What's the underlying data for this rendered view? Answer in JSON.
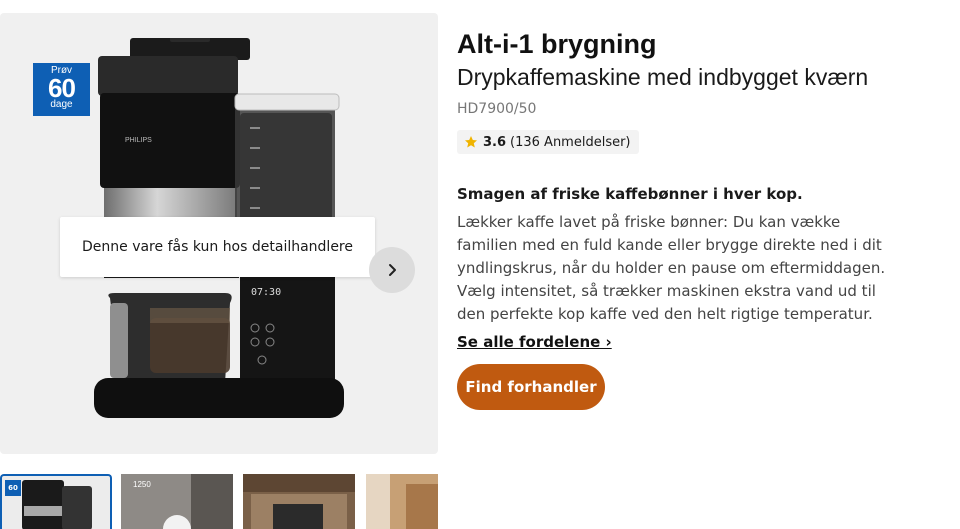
{
  "gallery": {
    "badge": {
      "top": "Prøv",
      "number": "60",
      "bottom": "dage"
    },
    "brand": "PHILIPS",
    "display_time": "07:30",
    "notice": "Denne vare fås kun hos detailhandlere",
    "thumbnails": [
      {
        "badge": "60"
      },
      {
        "label": "1250"
      },
      {},
      {}
    ]
  },
  "product": {
    "title": "Alt-i-1 brygning",
    "subtitle": "Drypkaffemaskine med indbygget kværn",
    "model": "HD7900/50",
    "rating": {
      "score": "3.6",
      "reviews": "(136 Anmeldelser)"
    },
    "tagline": "Smagen af friske kaffebønner i hver kop.",
    "description": "Lækker kaffe lavet på friske bønner: Du kan vække familien med en fuld kande eller brygge direkte ned i dit yndlingskrus, når du holder en pause om eftermiddagen. Vælg intensitet, så trækker maskinen ekstra vand ud til den perfekte kop kaffe ved den helt rigtige temperatur.",
    "see_all": "Se alle fordelene ›",
    "cta": "Find forhandler"
  },
  "colors": {
    "accent": "#c05a10",
    "badge_blue": "#0e5fb4",
    "star": "#f0b400"
  }
}
